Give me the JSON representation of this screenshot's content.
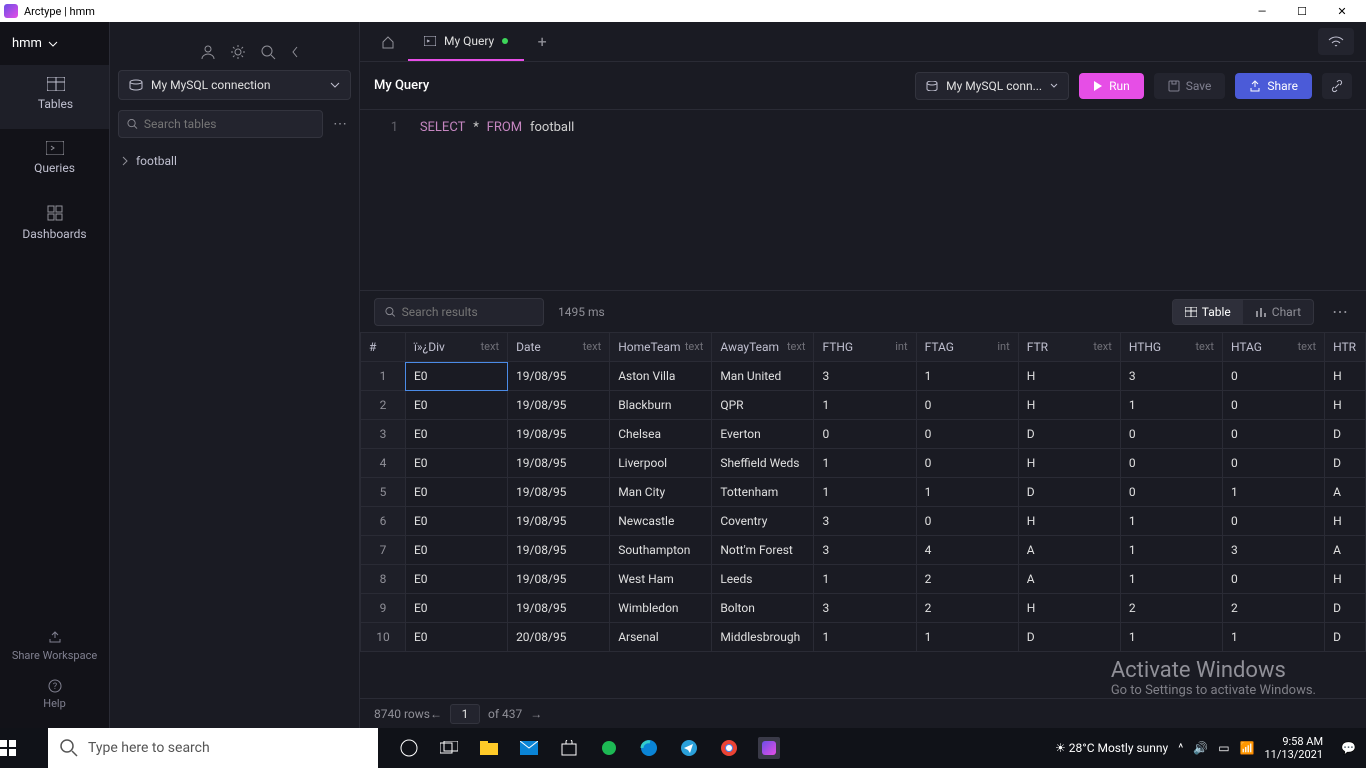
{
  "titlebar": {
    "text": "Arctype | hmm"
  },
  "workspace": {
    "name": "hmm"
  },
  "nav": {
    "tables": "Tables",
    "queries": "Queries",
    "dashboards": "Dashboards",
    "share": "Share Workspace",
    "help": "Help"
  },
  "sidebar": {
    "connection": "My MySQL connection",
    "search_placeholder": "Search tables",
    "tree": {
      "table": "football"
    }
  },
  "tabs": {
    "active": "My Query"
  },
  "toolbar": {
    "title": "My Query",
    "connection": "My MySQL conn...",
    "run": "Run",
    "save": "Save",
    "share": "Share"
  },
  "editor": {
    "line": "1",
    "kw1": "SELECT",
    "star": "*",
    "kw2": "FROM",
    "ident": "football"
  },
  "results": {
    "search_placeholder": "Search results",
    "timing": "1495 ms",
    "view_table": "Table",
    "view_chart": "Chart",
    "columns": [
      {
        "name": "#",
        "type": ""
      },
      {
        "name": "ï»¿Div",
        "type": "text"
      },
      {
        "name": "Date",
        "type": "text"
      },
      {
        "name": "HomeTeam",
        "type": "text"
      },
      {
        "name": "AwayTeam",
        "type": "text"
      },
      {
        "name": "FTHG",
        "type": "int"
      },
      {
        "name": "FTAG",
        "type": "int"
      },
      {
        "name": "FTR",
        "type": "text"
      },
      {
        "name": "HTHG",
        "type": "text"
      },
      {
        "name": "HTAG",
        "type": "text"
      },
      {
        "name": "HTR",
        "type": ""
      }
    ],
    "rows": [
      [
        "1",
        "E0",
        "19/08/95",
        "Aston Villa",
        "Man United",
        "3",
        "1",
        "H",
        "3",
        "0",
        "H"
      ],
      [
        "2",
        "E0",
        "19/08/95",
        "Blackburn",
        "QPR",
        "1",
        "0",
        "H",
        "1",
        "0",
        "H"
      ],
      [
        "3",
        "E0",
        "19/08/95",
        "Chelsea",
        "Everton",
        "0",
        "0",
        "D",
        "0",
        "0",
        "D"
      ],
      [
        "4",
        "E0",
        "19/08/95",
        "Liverpool",
        "Sheffield Weds",
        "1",
        "0",
        "H",
        "0",
        "0",
        "D"
      ],
      [
        "5",
        "E0",
        "19/08/95",
        "Man City",
        "Tottenham",
        "1",
        "1",
        "D",
        "0",
        "1",
        "A"
      ],
      [
        "6",
        "E0",
        "19/08/95",
        "Newcastle",
        "Coventry",
        "3",
        "0",
        "H",
        "1",
        "0",
        "H"
      ],
      [
        "7",
        "E0",
        "19/08/95",
        "Southampton",
        "Nott'm Forest",
        "3",
        "4",
        "A",
        "1",
        "3",
        "A"
      ],
      [
        "8",
        "E0",
        "19/08/95",
        "West Ham",
        "Leeds",
        "1",
        "2",
        "A",
        "1",
        "0",
        "H"
      ],
      [
        "9",
        "E0",
        "19/08/95",
        "Wimbledon",
        "Bolton",
        "3",
        "2",
        "H",
        "2",
        "2",
        "D"
      ],
      [
        "10",
        "E0",
        "20/08/95",
        "Arsenal",
        "Middlesbrough",
        "1",
        "1",
        "D",
        "1",
        "1",
        "D"
      ]
    ],
    "footer": {
      "rowcount": "8740 rows",
      "page": "1",
      "of": "of 437"
    }
  },
  "watermark": {
    "line1": "Activate Windows",
    "line2": "Go to Settings to activate Windows."
  },
  "taskbar": {
    "search_placeholder": "Type here to search",
    "weather": "28°C  Mostly sunny",
    "time": "9:58 AM",
    "date": "11/13/2021"
  }
}
